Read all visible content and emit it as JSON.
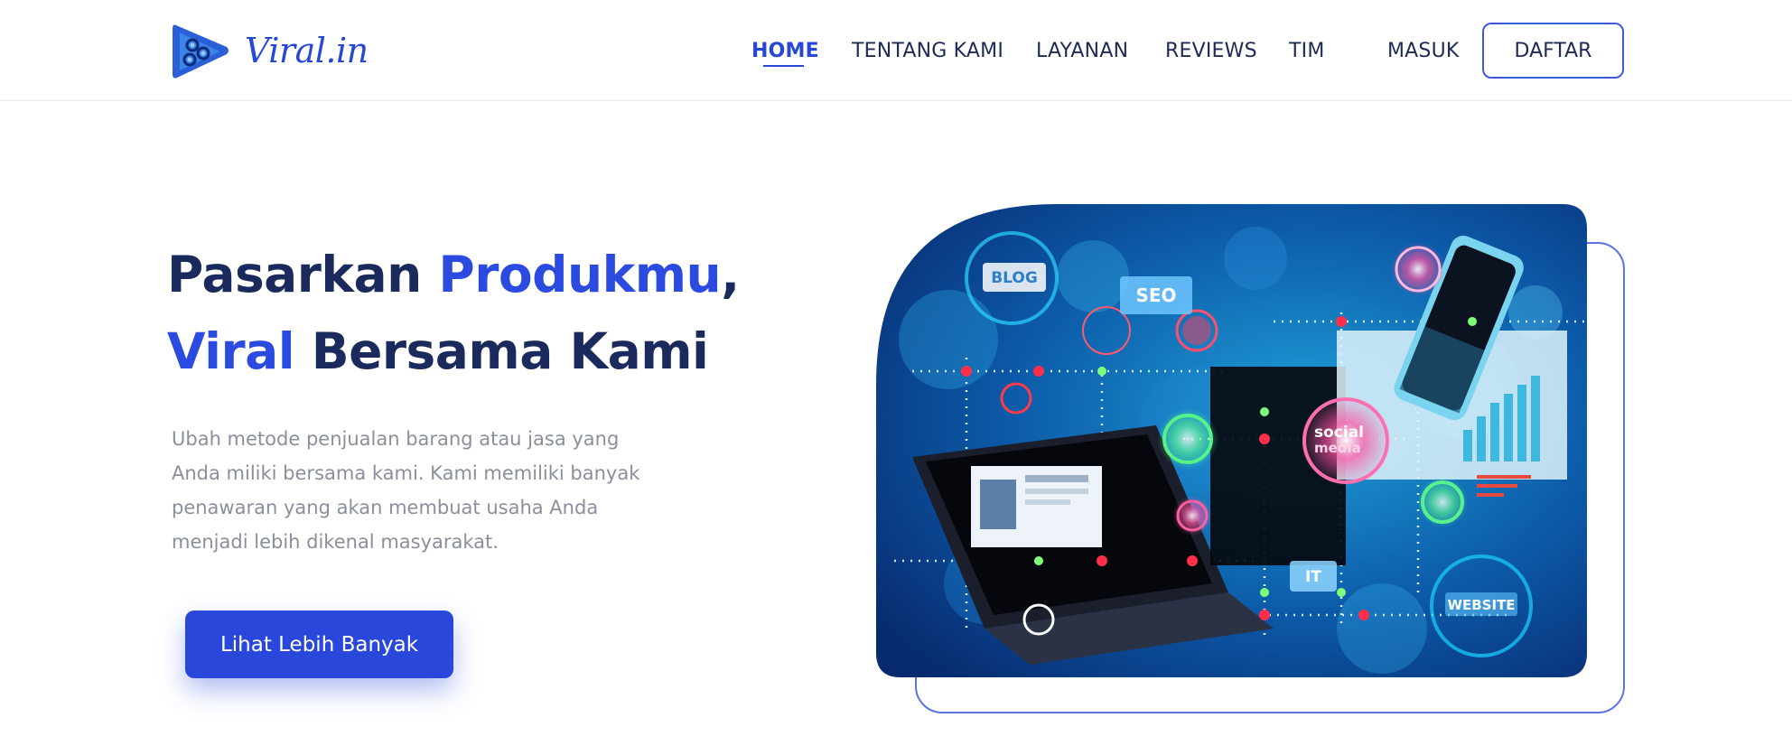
{
  "brand": {
    "name": "Viral.in"
  },
  "nav": {
    "items": [
      {
        "label": "HOME",
        "active": true
      },
      {
        "label": "TENTANG KAMI",
        "active": false
      },
      {
        "label": "LAYANAN",
        "active": false
      },
      {
        "label": "REVIEWS",
        "active": false
      },
      {
        "label": "TIM",
        "active": false
      }
    ],
    "login_label": "MASUK",
    "register_label": "DAFTAR"
  },
  "hero": {
    "title_line1_a": "Pasarkan ",
    "title_line1_b": "Produkmu",
    "title_line1_c": ",",
    "title_line2_a": "Viral",
    "title_line2_b": " Bersama Kami",
    "description_lines": [
      "Ubah metode penjualan barang atau jasa yang",
      "Anda miliki bersama kami. Kami memiliki banyak",
      "penawaran yang akan membuat usaha Anda",
      "menjadi lebih dikenal masyarakat."
    ],
    "cta_label": "Lihat Lebih Banyak",
    "image_labels": {
      "blog": "BLOG",
      "seo": "SEO",
      "social_1": "social",
      "social_2": "media",
      "it": "IT",
      "website": "WEBSITE"
    }
  },
  "colors": {
    "accent": "#2b4ae0",
    "navy": "#1a2a5c",
    "muted_text": "#8a8f9c",
    "image_bg": "#0a3f86"
  }
}
